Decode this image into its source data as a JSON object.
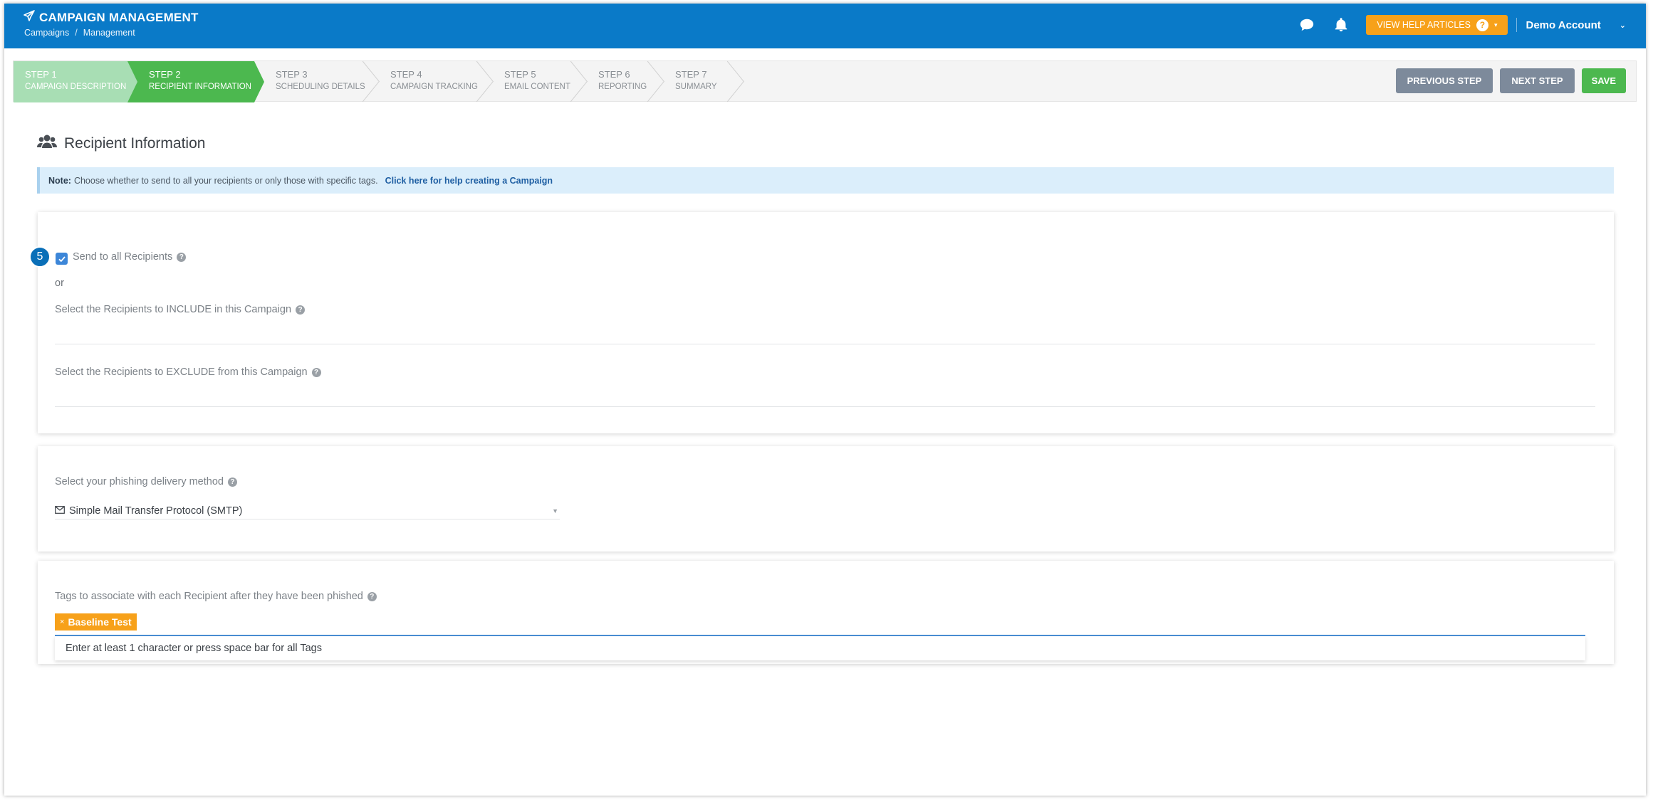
{
  "header": {
    "title": "CAMPAIGN MANAGEMENT",
    "breadcrumb": [
      "Campaigns",
      "/",
      "Management"
    ],
    "help_label": "VIEW HELP ARTICLES",
    "help_badge": "?",
    "account": "Demo Account",
    "icons": [
      "chat-icon",
      "bell-icon",
      "chevron-down-icon"
    ],
    "colors": {
      "bar": "#0a7ac8",
      "help": "#f7a11a"
    }
  },
  "wizard": {
    "steps": [
      {
        "num": "STEP 1",
        "label": "CAMPAIGN DESCRIPTION",
        "state": "done"
      },
      {
        "num": "STEP 2",
        "label": "RECIPIENT INFORMATION",
        "state": "active"
      },
      {
        "num": "STEP 3",
        "label": "SCHEDULING DETAILS",
        "state": "pending"
      },
      {
        "num": "STEP 4",
        "label": "CAMPAIGN TRACKING",
        "state": "pending"
      },
      {
        "num": "STEP 5",
        "label": "EMAIL CONTENT",
        "state": "pending"
      },
      {
        "num": "STEP 6",
        "label": "REPORTING",
        "state": "pending"
      },
      {
        "num": "STEP 7",
        "label": "SUMMARY",
        "state": "pending"
      }
    ],
    "prev_label": "PREVIOUS STEP",
    "next_label": "NEXT STEP",
    "save_label": "SAVE",
    "colors": {
      "done": "#a8deb4",
      "active": "#4cb84f",
      "nav_button": "#7d8a9b"
    }
  },
  "main": {
    "title": "Recipient Information",
    "note": {
      "prefix": "Note:",
      "text": "Choose whether to send to all your recipients or only those with specific tags.",
      "link": "Click here for help creating a Campaign"
    },
    "recipients": {
      "step_badge": "5",
      "send_all_label": "Send to all Recipients",
      "send_all_checked": true,
      "or_text": "or",
      "include_label": "Select the Recipients to INCLUDE in this Campaign",
      "exclude_label": "Select the Recipients to EXCLUDE from this Campaign"
    },
    "delivery": {
      "label": "Select your phishing delivery method",
      "selected": "Simple Mail Transfer Protocol (SMTP)"
    },
    "tags": {
      "label": "Tags to associate with each Recipient after they have been phished",
      "items": [
        "Baseline Test"
      ],
      "hint": "Enter at least 1 character or press space bar for all Tags"
    }
  }
}
